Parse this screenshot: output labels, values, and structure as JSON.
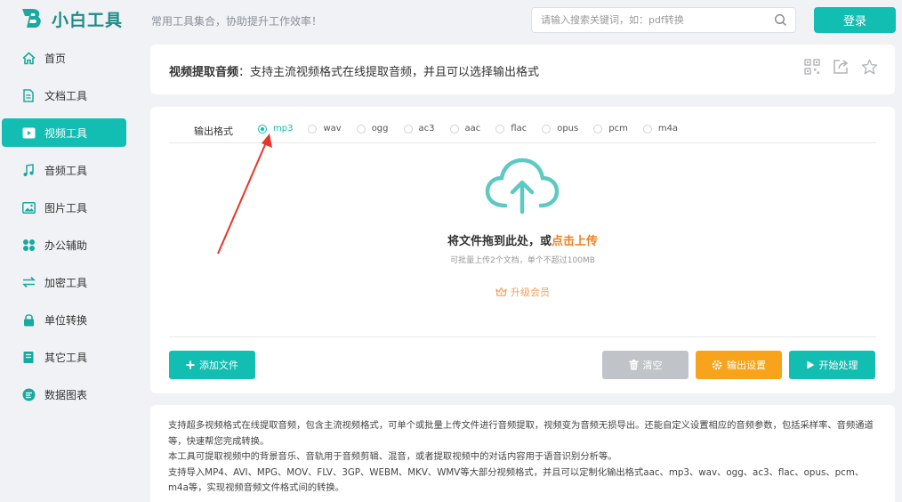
{
  "header": {
    "logo_text": "小白工具",
    "slogan": "常用工具集合，协助提升工作效率！",
    "search_placeholder": "请输入搜索关键词，如：pdf转换",
    "login_label": "登录"
  },
  "sidebar": {
    "items": [
      {
        "label": "首页",
        "icon": "home-icon"
      },
      {
        "label": "文档工具",
        "icon": "document-icon"
      },
      {
        "label": "视频工具",
        "icon": "video-icon",
        "active": true
      },
      {
        "label": "音频工具",
        "icon": "music-icon"
      },
      {
        "label": "图片工具",
        "icon": "image-icon"
      },
      {
        "label": "办公辅助",
        "icon": "grid-icon"
      },
      {
        "label": "加密工具",
        "icon": "swap-icon"
      },
      {
        "label": "单位转换",
        "icon": "lock-icon"
      },
      {
        "label": "其它工具",
        "icon": "book-icon"
      },
      {
        "label": "数据图表",
        "icon": "chart-icon"
      }
    ]
  },
  "title_card": {
    "title_bold": "视频提取音频",
    "title_rest": "：支持主流视频格式在线提取音频，并且可以选择输出格式",
    "actions": [
      "qrcode-icon",
      "share-icon",
      "star-icon"
    ]
  },
  "format": {
    "label": "输出格式",
    "selected": "mp3",
    "options": [
      "mp3",
      "wav",
      "ogg",
      "ac3",
      "aac",
      "flac",
      "opus",
      "pcm",
      "m4a"
    ]
  },
  "dropzone": {
    "title_prefix": "将文件拖到此处，或",
    "title_link": "点击上传",
    "subtitle": "可批量上传2个文档，单个不超过100MB",
    "upgrade_label": "升级会员"
  },
  "buttons": {
    "add": "添加文件",
    "clear": "清空",
    "settings": "输出设置",
    "start": "开始处理"
  },
  "description": {
    "line1": "支持超多视频格式在线提取音频，包含主流视频格式，可单个或批量上传文件进行音频提取，视频变为音频无损导出。还能自定义设置相应的音频参数，包括采样率、音频通道等，快速帮您完成转换。",
    "line2": "本工具可提取视频中的背景音乐、音轨用于音频剪辑、混音，或者提取视频中的对话内容用于语音识别分析等。",
    "line3": "支持导入MP4、AVI、MPG、MOV、FLV、3GP、WEBM、MKV、WMV等大部分视频格式，并且可以定制化输出格式aac、mp3、wav、ogg、ac3、flac、opus、pcm、m4a等，实现视频音频文件格式间的转换。"
  },
  "colors": {
    "accent": "#12bdb1",
    "orange": "#f7a41c",
    "annotation": "#e8342a"
  }
}
